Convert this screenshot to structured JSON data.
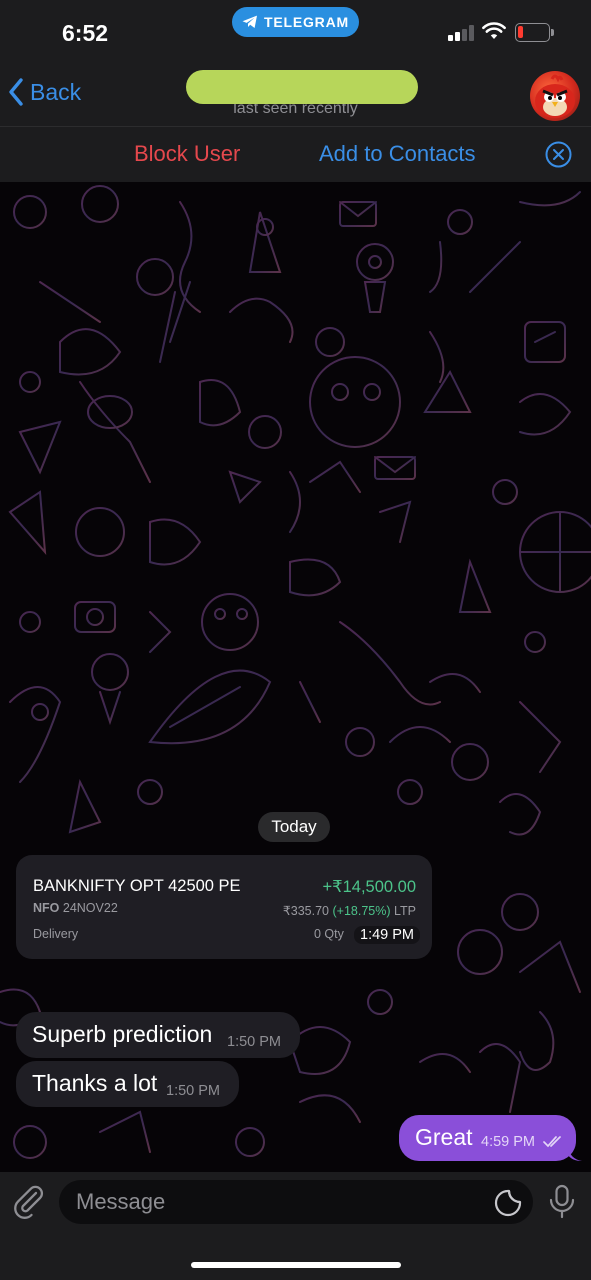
{
  "status_bar": {
    "time": "6:52",
    "app_badge": "TELEGRAM",
    "battery_color": "#ff3b30"
  },
  "header": {
    "back_label": "Back",
    "status": "last seen recently",
    "name_redaction_color": "#b7d65a"
  },
  "actions": {
    "block_label": "Block User",
    "add_contacts_label": "Add to Contacts"
  },
  "chat": {
    "date_separator": "Today",
    "trade_card": {
      "instrument": "BANKNIFTY OPT 42500 PE",
      "pnl": "+₹14,500.00",
      "exchange": "NFO",
      "expiry": "24NOV22",
      "ltp_price": "₹335.70",
      "ltp_change": "(+18.75%)",
      "ltp_suffix": "LTP",
      "product": "Delivery",
      "qty_prefix": "0 Qty",
      "time": "1:49 PM"
    },
    "messages": [
      {
        "direction": "incoming",
        "text": "Superb prediction",
        "time": "1:50 PM"
      },
      {
        "direction": "incoming",
        "text": "Thanks a lot",
        "time": "1:50 PM"
      },
      {
        "direction": "outgoing",
        "text": "Great",
        "time": "4:59 PM",
        "read": true
      }
    ]
  },
  "composer": {
    "placeholder": "Message"
  },
  "colors": {
    "accent_blue": "#3a8ee6",
    "danger_red": "#e5484d",
    "outgoing_bubble": "#8a4fd9",
    "profit_green": "#4cc38a"
  }
}
